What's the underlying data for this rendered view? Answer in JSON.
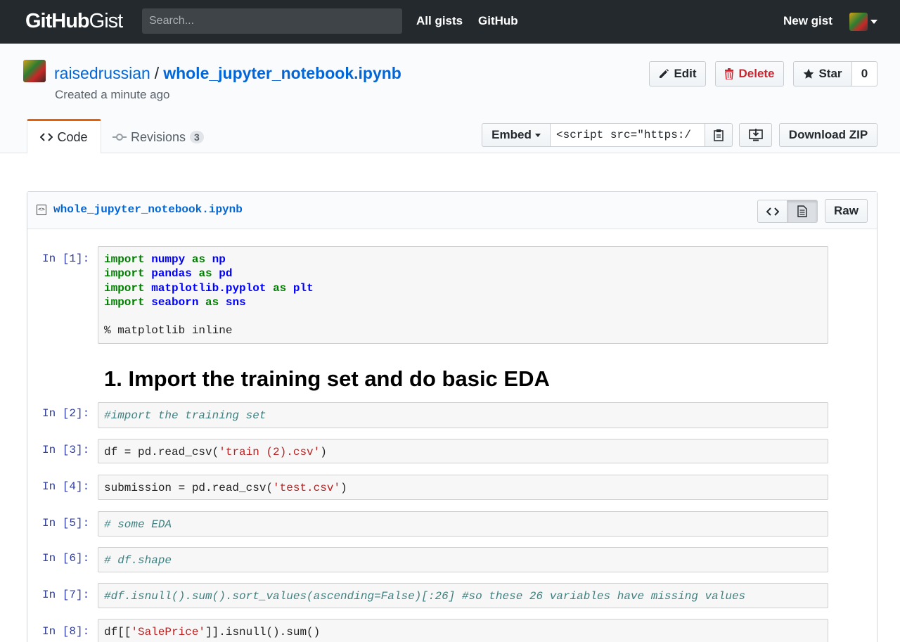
{
  "header": {
    "logo_github": "GitHub",
    "logo_gist": "Gist",
    "search_placeholder": "Search...",
    "nav": [
      "All gists",
      "GitHub"
    ],
    "new_gist": "New gist"
  },
  "gist": {
    "owner": "raisedrussian",
    "separator": "/",
    "filename": "whole_jupyter_notebook.ipynb",
    "meta": "Created a minute ago",
    "actions": {
      "edit": "Edit",
      "delete": "Delete",
      "star": "Star",
      "star_count": "0"
    },
    "tabs": {
      "code": "Code",
      "revisions": "Revisions",
      "revisions_count": "3"
    },
    "embed": {
      "label": "Embed",
      "value": "<script src=\"https:/"
    },
    "download_zip": "Download ZIP"
  },
  "file": {
    "name": "whole_jupyter_notebook.ipynb",
    "raw": "Raw"
  },
  "notebook": {
    "cell1": {
      "prompt": "In [1]:",
      "lines": [
        {
          "kw": "import",
          "mod": "numpy",
          "as": "as",
          "alias": "np"
        },
        {
          "kw": "import",
          "mod": "pandas",
          "as": "as",
          "alias": "pd"
        },
        {
          "kw": "import",
          "mod": "matplotlib.pyplot",
          "as": "as",
          "alias": "plt"
        },
        {
          "kw": "import",
          "mod": "seaborn",
          "as": "as",
          "alias": "sns"
        }
      ],
      "magic": "% matplotlib inline"
    },
    "heading": "1. Import the training set and do basic EDA",
    "cell2": {
      "prompt": "In [2]:",
      "comment": "#import the training set"
    },
    "cell3": {
      "prompt": "In [3]:",
      "pre": "df = pd.read_csv(",
      "str": "'train (2).csv'",
      "post": ")"
    },
    "cell4": {
      "prompt": "In [4]:",
      "pre": "submission = pd.read_csv(",
      "str": "'test.csv'",
      "post": ")"
    },
    "cell5": {
      "prompt": "In [5]:",
      "comment": "# some EDA"
    },
    "cell6": {
      "prompt": "In [6]:",
      "comment": "# df.shape"
    },
    "cell7": {
      "prompt": "In [7]:",
      "comment": "#df.isnull().sum().sort_values(ascending=False)[:26] #so these 26 variables have missing values"
    },
    "cell8": {
      "prompt": "In [8]:",
      "pre": "df[[",
      "str": "'SalePrice'",
      "post": "]].isnull().sum()"
    }
  }
}
